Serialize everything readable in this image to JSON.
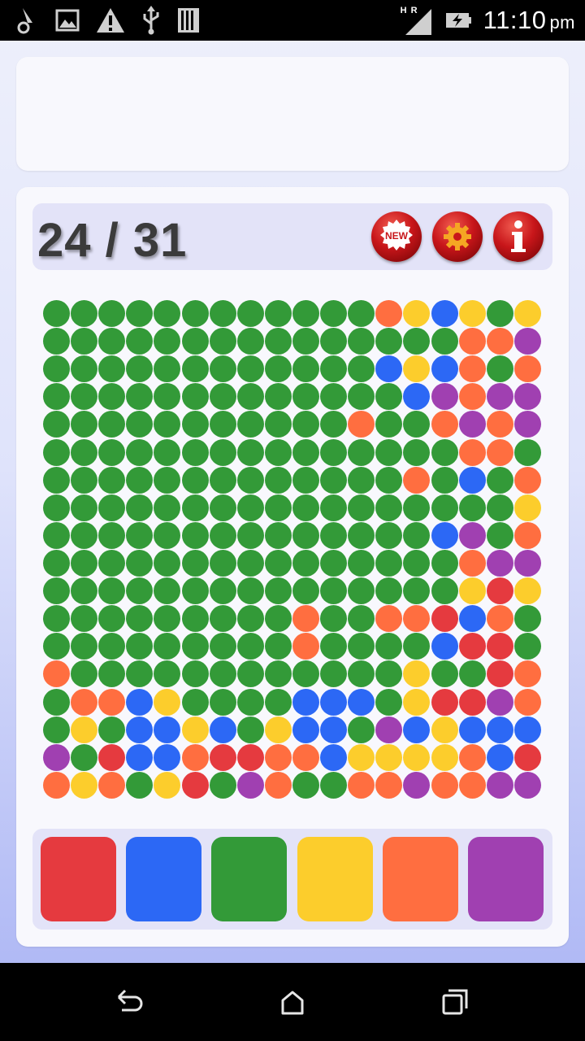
{
  "status_bar": {
    "time": "11:10",
    "ampm": "pm",
    "network_label": "H R",
    "icons": [
      "key-notification-icon",
      "image-notification-icon",
      "warning-icon",
      "usb-icon",
      "sd-card-icon",
      "signal-icon",
      "battery-charging-icon"
    ]
  },
  "header": {
    "score": "24 / 31",
    "buttons": [
      {
        "name": "new-game-button",
        "icon": "new-badge-icon",
        "label": "NEW"
      },
      {
        "name": "settings-button",
        "icon": "gear-icon",
        "label": ""
      },
      {
        "name": "info-button",
        "icon": "info-icon",
        "label": ""
      }
    ]
  },
  "colors": {
    "R": "#e53a3f",
    "B": "#2c68f5",
    "G": "#339a38",
    "Y": "#fccd2c",
    "O": "#ff6e40",
    "P": "#a040b1"
  },
  "board": [
    "GGGGGGGGGGGGOYBYGY",
    "GGGGGGGGGGGGGGGOOP",
    "GGGGGGGGGGGGBYBOGO",
    "GGGGGGGGGGGGGBPOPP",
    "GGGGGGGGGGGOGGOPOP",
    "GGGGGGGGGGGGGGGOOG",
    "GGGGGGGGGGGGGOGBGO",
    "GGGGGGGGGGGGGGGGGY",
    "GGGGGGGGGGGGGGBPGO",
    "GGGGGGGGGGGGGGGOPP",
    "GGGGGGGGGGGGGGGYRY",
    "GGGGGGGGGOGGOORBOG",
    "GGGGGGGGGOGGGGBRRG",
    "OGGGGGGGGGGGGYGGRO",
    "GOOBYGGGGBBBGYRRPO",
    "GYGBBYBGYBBGPBYBBB",
    "PGRBBORROOBYYYYOBR",
    "OYOGYRGPOGGOOPOOPP"
  ],
  "palette": [
    {
      "name": "red",
      "color_key": "R"
    },
    {
      "name": "blue",
      "color_key": "B"
    },
    {
      "name": "green",
      "color_key": "G"
    },
    {
      "name": "yellow",
      "color_key": "Y"
    },
    {
      "name": "orange",
      "color_key": "O"
    },
    {
      "name": "purple",
      "color_key": "P"
    }
  ],
  "nav_bar": {
    "icons": [
      "back-icon",
      "home-icon",
      "recents-icon"
    ]
  }
}
